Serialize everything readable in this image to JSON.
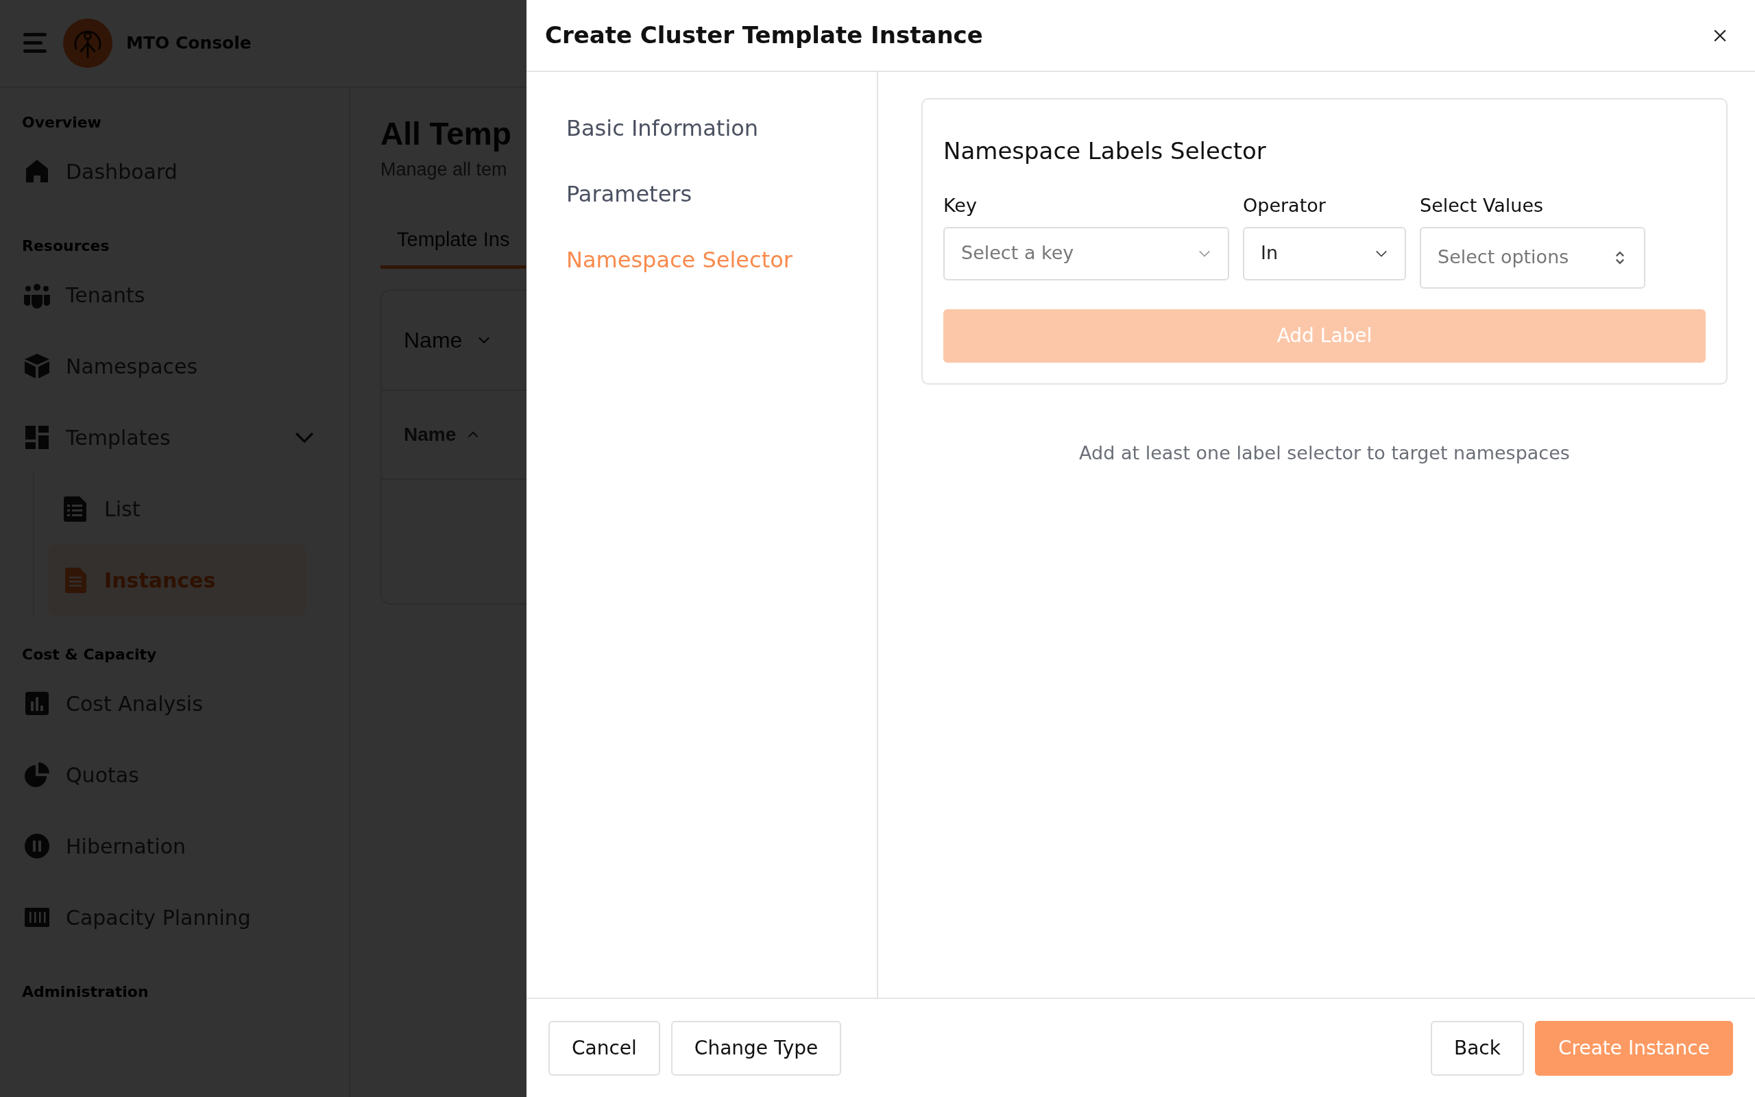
{
  "app": {
    "title": "MTO Console"
  },
  "sidebar": {
    "sections": [
      {
        "heading": "Overview",
        "items": [
          {
            "label": "Dashboard",
            "selected": false
          }
        ]
      },
      {
        "heading": "Resources",
        "items": [
          {
            "label": "Tenants",
            "selected": false
          },
          {
            "label": "Namespaces",
            "selected": false
          },
          {
            "label": "Templates",
            "selected": false,
            "expanded": true,
            "children": [
              {
                "label": "List",
                "selected": false
              },
              {
                "label": "Instances",
                "selected": true
              }
            ]
          }
        ]
      },
      {
        "heading": "Cost & Capacity",
        "items": [
          {
            "label": "Cost Analysis",
            "selected": false
          },
          {
            "label": "Quotas",
            "selected": false
          },
          {
            "label": "Hibernation",
            "selected": false
          },
          {
            "label": "Capacity Planning",
            "selected": false
          }
        ]
      },
      {
        "heading": "Administration"
      }
    ]
  },
  "main": {
    "title": "All Temp",
    "subtitle": "Manage all tem",
    "tabs": [
      {
        "label": "Template Ins",
        "selected": true
      }
    ],
    "filter": "Name",
    "columns": [
      "Name"
    ]
  },
  "dialog": {
    "title": "Create Cluster Template Instance",
    "steps": [
      {
        "label": "Basic Information",
        "selected": false
      },
      {
        "label": "Parameters",
        "selected": false
      },
      {
        "label": "Namespace Selector",
        "selected": true
      }
    ],
    "section": {
      "title": "Namespace Labels Selector",
      "fields": [
        {
          "label": "Key",
          "kind": "select",
          "placeholder": "Select a key"
        },
        {
          "label": "Operator",
          "kind": "select",
          "value": "In"
        },
        {
          "label": "Select Values",
          "kind": "multiselect",
          "placeholder": "Select options"
        }
      ],
      "add_button": {
        "label": "Add Label",
        "disabled": true
      }
    },
    "hint": "Add at least one label selector to target namespaces",
    "footer": {
      "left": [
        {
          "label": "Cancel",
          "kind": "secondary"
        },
        {
          "label": "Change Type",
          "kind": "secondary"
        }
      ],
      "right": [
        {
          "label": "Back",
          "kind": "secondary"
        },
        {
          "label": "Create Instance",
          "kind": "primary"
        }
      ]
    }
  }
}
